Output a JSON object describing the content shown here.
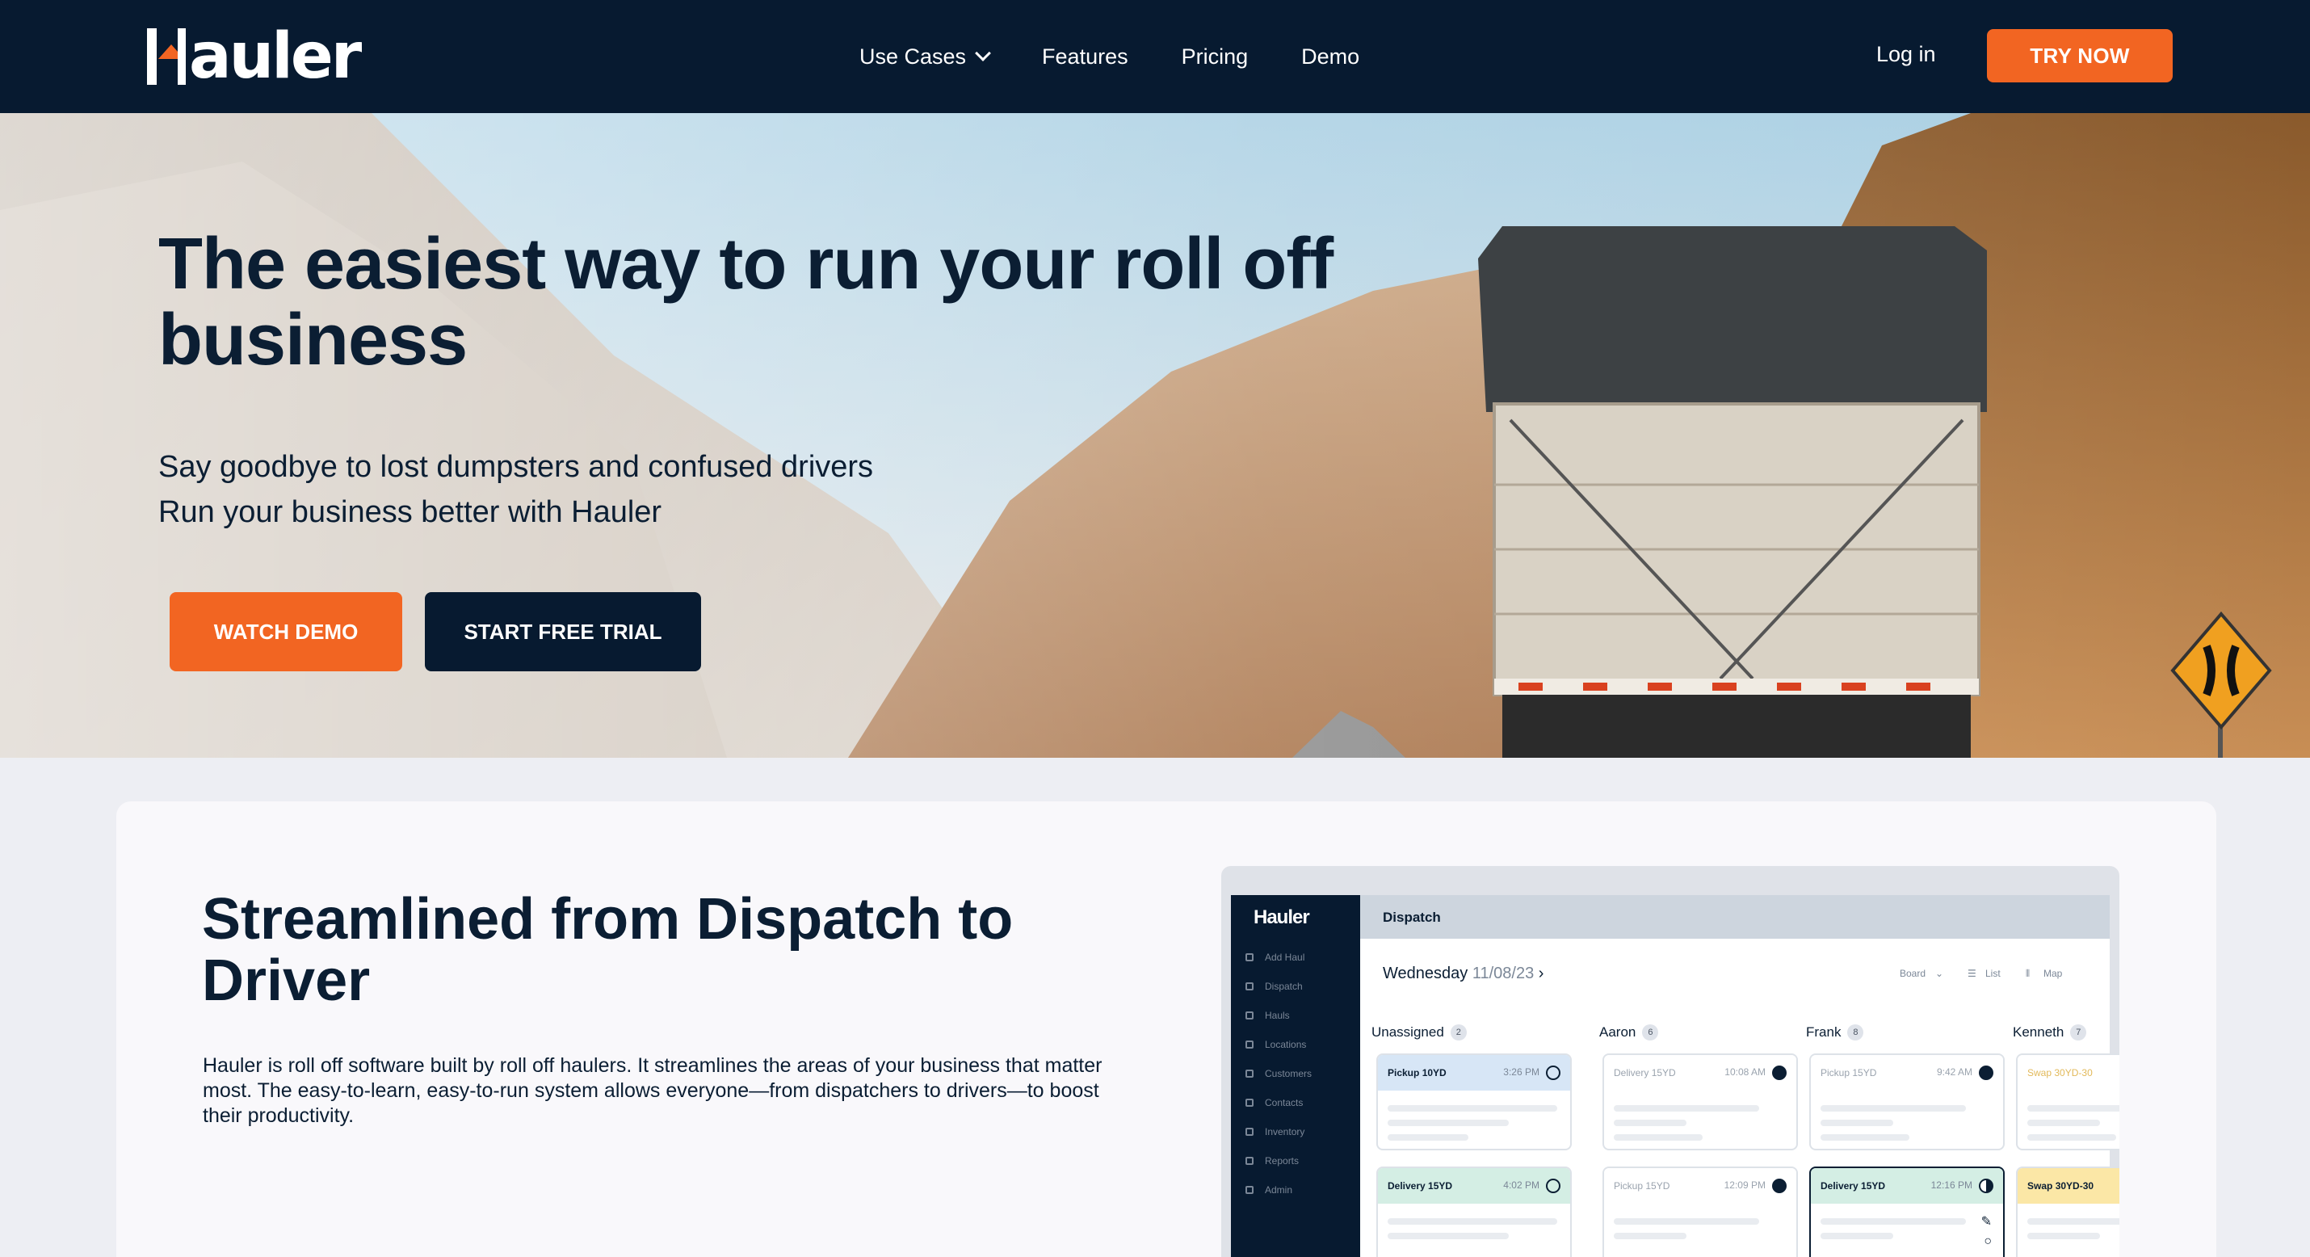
{
  "nav": {
    "logo": "auler",
    "links": [
      "Use Cases",
      "Features",
      "Pricing",
      "Demo"
    ],
    "login": "Log in",
    "cta": "TRY NOW"
  },
  "hero": {
    "title": "The easiest way to run your roll off business",
    "subtitle_line1": "Say goodbye to lost dumpsters and confused drivers",
    "subtitle_line2": "Run your business better with Hauler",
    "watch_demo": "WATCH DEMO",
    "start_trial": "START FREE TRIAL"
  },
  "section": {
    "title": "Streamlined from Dispatch to Driver",
    "body": "Hauler is roll off software built by roll off haulers. It streamlines the areas of your business that matter most. The easy-to-learn, easy-to-run system allows everyone—from dispatchers to drivers—to boost their productivity."
  },
  "app": {
    "logo": "Hauler",
    "header": "Dispatch",
    "day": "Wednesday",
    "date": "11/08/23",
    "views": [
      "Board",
      "List",
      "Map"
    ],
    "sidebar": [
      "Add Haul",
      "Dispatch",
      "Hauls",
      "Locations",
      "Customers",
      "Contacts",
      "Inventory",
      "Reports",
      "Admin"
    ],
    "columns": [
      {
        "name": "Unassigned",
        "count": "2"
      },
      {
        "name": "Aaron",
        "count": "6"
      },
      {
        "name": "Frank",
        "count": "8"
      },
      {
        "name": "Kenneth",
        "count": "7"
      }
    ],
    "cards": [
      {
        "type": "Pickup",
        "size": "10YD",
        "time": "3:26 PM"
      },
      {
        "type": "Delivery",
        "size": "15YD",
        "time": "10:08 AM"
      },
      {
        "type": "Pickup",
        "size": "15YD",
        "time": "9:42 AM"
      },
      {
        "type": "Swap",
        "size": "30YD-30",
        "time": ""
      },
      {
        "type": "Delivery",
        "size": "15YD",
        "time": "4:02 PM"
      },
      {
        "type": "Pickup",
        "size": "15YD",
        "time": "12:09 PM"
      },
      {
        "type": "Delivery",
        "size": "15YD",
        "time": "12:16 PM"
      },
      {
        "type": "Swap",
        "size": "30YD-30",
        "time": ""
      }
    ]
  }
}
